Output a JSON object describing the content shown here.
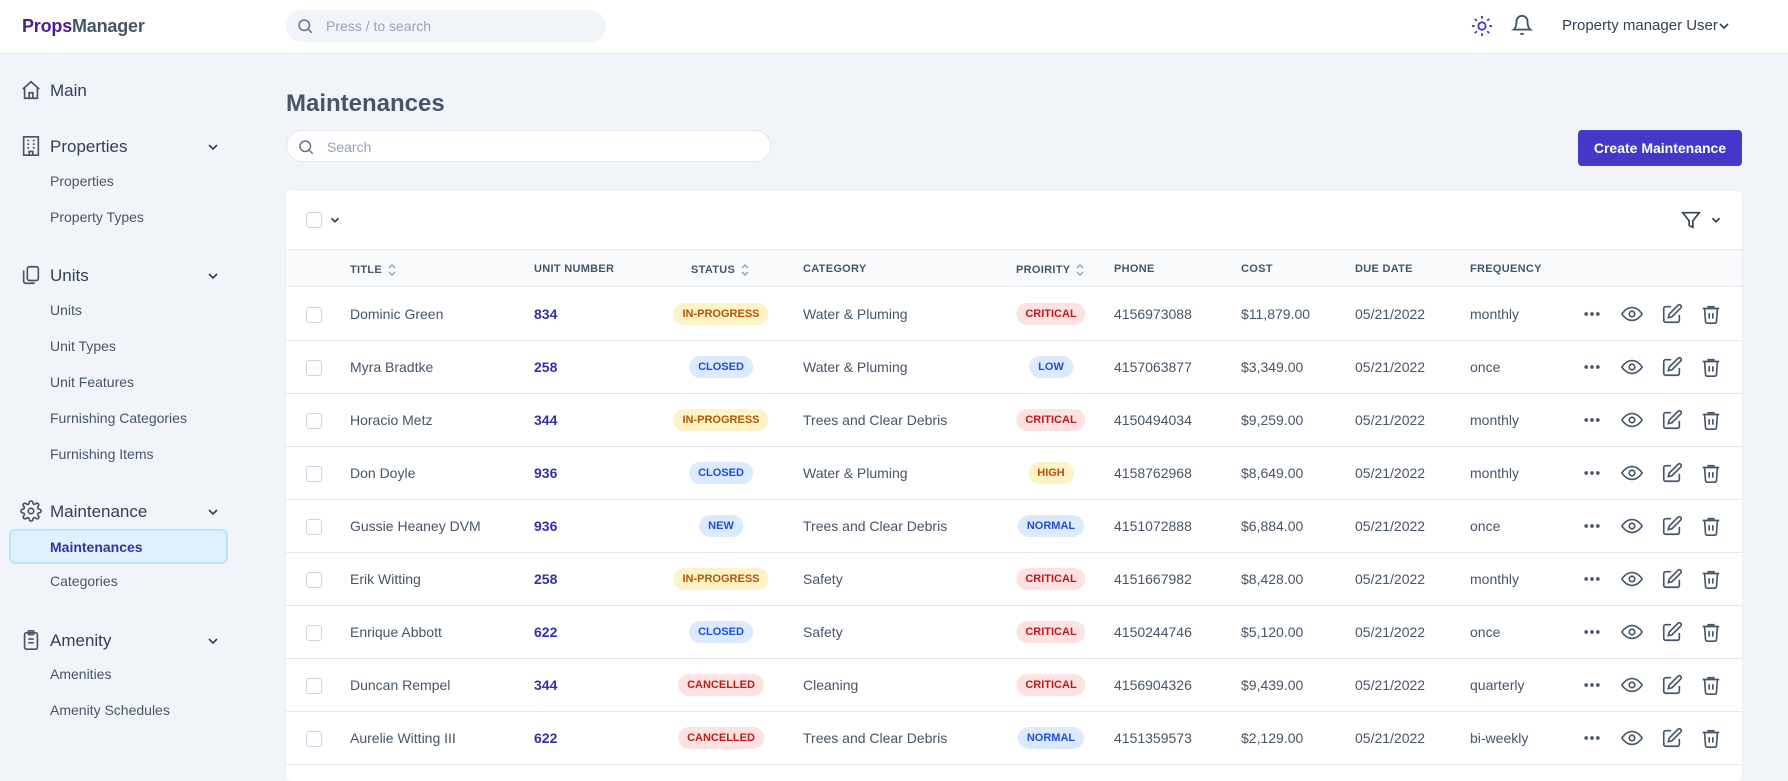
{
  "app": {
    "logo_a": "Props",
    "logo_b": "Manager"
  },
  "topbar": {
    "search_placeholder": "Press / to search",
    "user_name": "Property manager User"
  },
  "sidebar": {
    "sections": [
      {
        "label": "Main",
        "icon": "home-icon",
        "items": []
      },
      {
        "label": "Properties",
        "icon": "building-icon",
        "items": [
          "Properties",
          "Property Types"
        ]
      },
      {
        "label": "Units",
        "icon": "copy-icon",
        "items": [
          "Units",
          "Unit Types",
          "Unit Features",
          "Furnishing Categories",
          "Furnishing Items"
        ]
      },
      {
        "label": "Maintenance",
        "icon": "gear-icon",
        "items": [
          "Maintenances",
          "Categories"
        ]
      },
      {
        "label": "Amenity",
        "icon": "clipboard-icon",
        "items": [
          "Amenities",
          "Amenity Schedules"
        ]
      }
    ],
    "active_item": "Maintenances"
  },
  "page": {
    "title": "Maintenances",
    "search_placeholder": "Search",
    "create_label": "Create Maintenance"
  },
  "table": {
    "columns": [
      "TITLE",
      "UNIT NUMBER",
      "STATUS",
      "CATEGORY",
      "PROIRITY",
      "PHONE",
      "COST",
      "DUE DATE",
      "FREQUENCY"
    ],
    "rows": [
      {
        "title": "Dominic Green",
        "unit": "834",
        "status": "IN-PROGRESS",
        "category": "Water & Pluming",
        "priority": "CRITICAL",
        "phone": "4156973088",
        "cost": "$11,879.00",
        "due": "05/21/2022",
        "freq": "monthly"
      },
      {
        "title": "Myra Bradtke",
        "unit": "258",
        "status": "CLOSED",
        "category": "Water & Pluming",
        "priority": "LOW",
        "phone": "4157063877",
        "cost": "$3,349.00",
        "due": "05/21/2022",
        "freq": "once"
      },
      {
        "title": "Horacio Metz",
        "unit": "344",
        "status": "IN-PROGRESS",
        "category": "Trees and Clear Debris",
        "priority": "CRITICAL",
        "phone": "4150494034",
        "cost": "$9,259.00",
        "due": "05/21/2022",
        "freq": "monthly"
      },
      {
        "title": "Don Doyle",
        "unit": "936",
        "status": "CLOSED",
        "category": "Water & Pluming",
        "priority": "HIGH",
        "phone": "4158762968",
        "cost": "$8,649.00",
        "due": "05/21/2022",
        "freq": "monthly"
      },
      {
        "title": "Gussie Heaney DVM",
        "unit": "936",
        "status": "NEW",
        "category": "Trees and Clear Debris",
        "priority": "NORMAL",
        "phone": "4151072888",
        "cost": "$6,884.00",
        "due": "05/21/2022",
        "freq": "once"
      },
      {
        "title": "Erik Witting",
        "unit": "258",
        "status": "IN-PROGRESS",
        "category": "Safety",
        "priority": "CRITICAL",
        "phone": "4151667982",
        "cost": "$8,428.00",
        "due": "05/21/2022",
        "freq": "monthly"
      },
      {
        "title": "Enrique Abbott",
        "unit": "622",
        "status": "CLOSED",
        "category": "Safety",
        "priority": "CRITICAL",
        "phone": "4150244746",
        "cost": "$5,120.00",
        "due": "05/21/2022",
        "freq": "once"
      },
      {
        "title": "Duncan Rempel",
        "unit": "344",
        "status": "CANCELLED",
        "category": "Cleaning",
        "priority": "CRITICAL",
        "phone": "4156904326",
        "cost": "$9,439.00",
        "due": "05/21/2022",
        "freq": "quarterly"
      },
      {
        "title": "Aurelie Witting III",
        "unit": "622",
        "status": "CANCELLED",
        "category": "Trees and Clear Debris",
        "priority": "NORMAL",
        "phone": "4151359573",
        "cost": "$2,129.00",
        "due": "05/21/2022",
        "freq": "bi-weekly"
      }
    ],
    "row_actions": [
      "more-icon",
      "eye-icon",
      "edit-icon",
      "trash-icon"
    ]
  },
  "colors": {
    "accent": "#4338ca",
    "IN-PROGRESS": {
      "bg": "#fef3c7",
      "fg": "#b45309"
    },
    "CLOSED": {
      "bg": "#dbeafe",
      "fg": "#1d4ed8"
    },
    "NEW": {
      "bg": "#dbeafe",
      "fg": "#1d4ed8"
    },
    "CANCELLED": {
      "bg": "#fee2e2",
      "fg": "#b91c1c"
    },
    "CRITICAL": {
      "bg": "#fee2e2",
      "fg": "#b91c1c"
    },
    "LOW": {
      "bg": "#dbeafe",
      "fg": "#1d4ed8"
    },
    "HIGH": {
      "bg": "#fef3c7",
      "fg": "#b45309"
    },
    "NORMAL": {
      "bg": "#dbeafe",
      "fg": "#1d4ed8"
    }
  }
}
